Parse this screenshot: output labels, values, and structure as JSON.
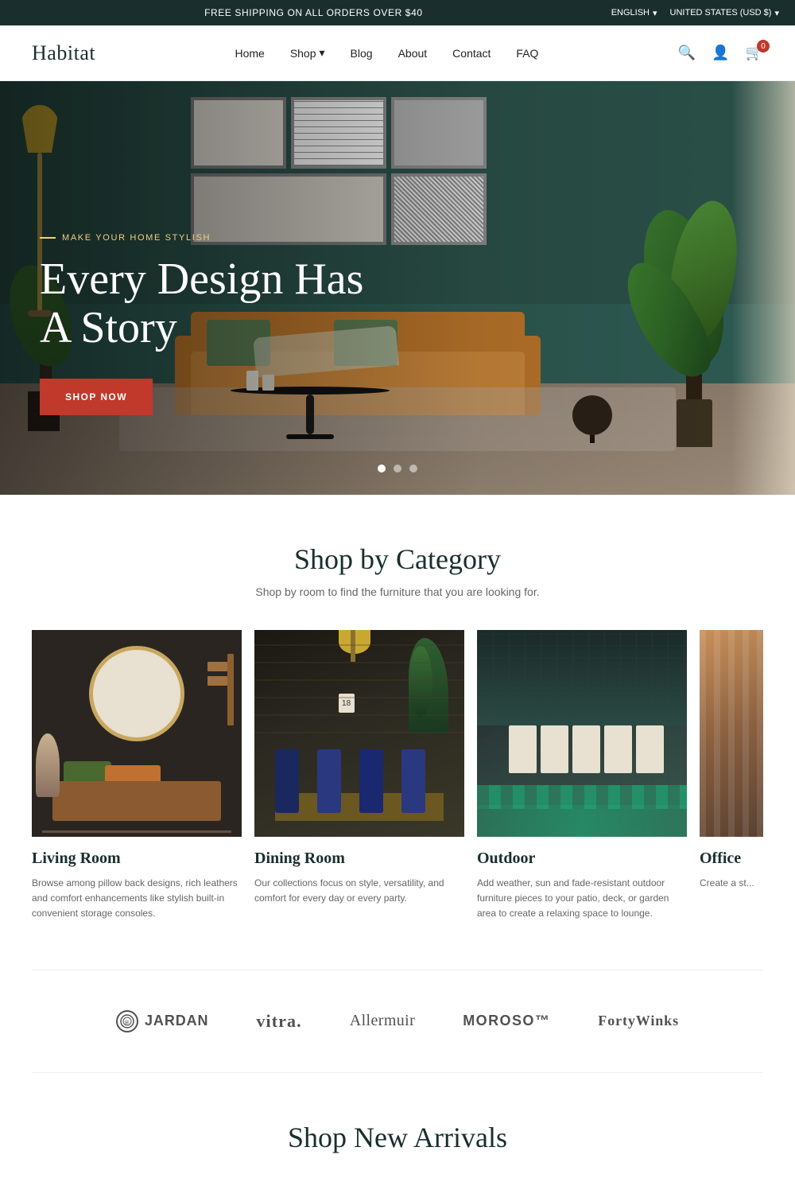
{
  "topbar": {
    "shipping_notice": "FREE SHIPPING ON ALL ORDERS OVER $40",
    "language": "ENGLISH",
    "currency": "UNITED STATES (USD $)"
  },
  "header": {
    "logo": "Habitat",
    "nav": [
      {
        "label": "Home",
        "href": "#"
      },
      {
        "label": "Shop",
        "href": "#",
        "has_dropdown": true
      },
      {
        "label": "Blog",
        "href": "#"
      },
      {
        "label": "About",
        "href": "#"
      },
      {
        "label": "Contact",
        "href": "#"
      },
      {
        "label": "FAQ",
        "href": "#"
      }
    ],
    "cart_count": "0"
  },
  "hero": {
    "subtitle": "MAKE YOUR HOME STYLISH",
    "title": "Every Design Has A Story",
    "cta_label": "SHOP NOW",
    "slides_count": 3,
    "active_slide": 0
  },
  "shop_category": {
    "title": "Shop by Category",
    "subtitle": "Shop by room to find the furniture that you are looking for.",
    "categories": [
      {
        "name": "Living Room",
        "description": "Browse among pillow back designs, rich leathers and comfort enhancements like stylish built-in convenient storage consoles."
      },
      {
        "name": "Dining Room",
        "description": "Our collections focus on style, versatility, and comfort for every day or every party."
      },
      {
        "name": "Outdoor",
        "description": "Add weather, sun and fade-resistant outdoor furniture pieces to your patio, deck, or garden area to create a relaxing space to lounge."
      },
      {
        "name": "Office",
        "description": "Create a stylish and functional workspace with our office furniture."
      }
    ]
  },
  "brands": {
    "logos": [
      {
        "name": "JARDAN",
        "style": "icon"
      },
      {
        "name": "vitra.",
        "style": "bold"
      },
      {
        "name": "Allermuir",
        "style": "normal"
      },
      {
        "name": "MOROSO™",
        "style": "normal"
      },
      {
        "name": "FortyWinks",
        "style": "normal"
      }
    ]
  },
  "arrivals": {
    "title": "Shop New Arrivals"
  },
  "icons": {
    "search": "🔍",
    "user": "👤",
    "cart": "🛒",
    "chevron_down": "▾"
  }
}
